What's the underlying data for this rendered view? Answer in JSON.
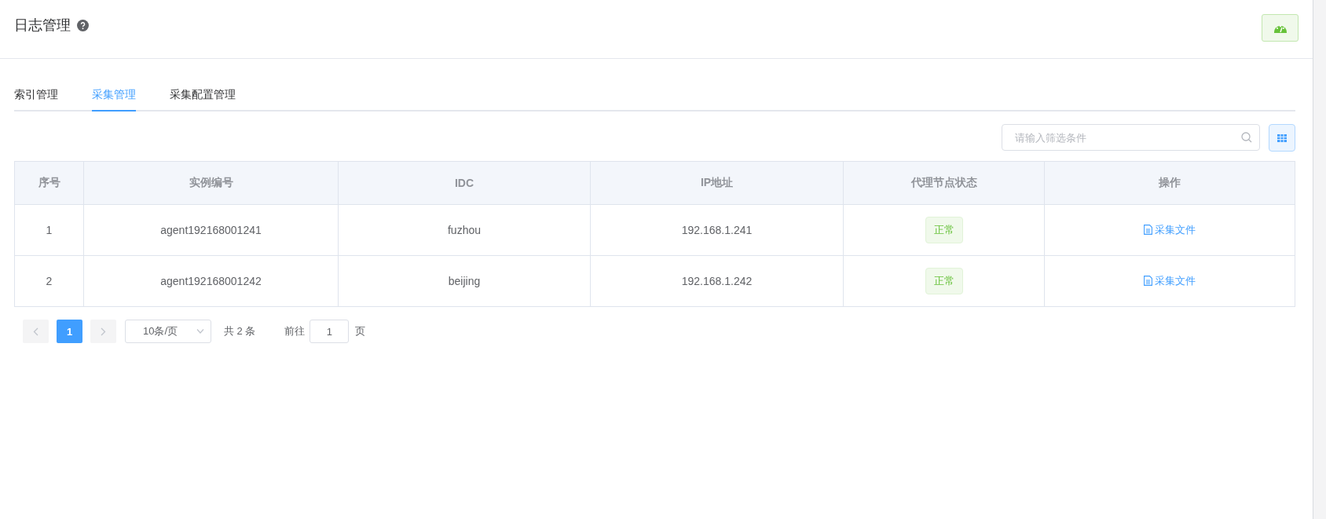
{
  "page": {
    "title": "日志管理"
  },
  "tabs": [
    {
      "label": "索引管理",
      "selected": false
    },
    {
      "label": "采集管理",
      "selected": true
    },
    {
      "label": "采集配置管理",
      "selected": false
    }
  ],
  "search": {
    "placeholder": "请输入筛选条件"
  },
  "table": {
    "columns": [
      "序号",
      "实例编号",
      "IDC",
      "IP地址",
      "代理节点状态",
      "操作"
    ],
    "rows": [
      {
        "cells": [
          "1",
          "agent192168001241",
          "fuzhou",
          "192.168.1.241"
        ],
        "status": "正常",
        "action": "采集文件"
      },
      {
        "cells": [
          "2",
          "agent192168001242",
          "beijing",
          "192.168.1.242"
        ],
        "status": "正常",
        "action": "采集文件"
      }
    ]
  },
  "pagination": {
    "pages": [
      {
        "label": "1",
        "selected": true
      }
    ],
    "page_size": "10条/页",
    "total": "共 2 条",
    "goto_label": "前往",
    "goto_value": "1",
    "page_suffix": "页"
  }
}
